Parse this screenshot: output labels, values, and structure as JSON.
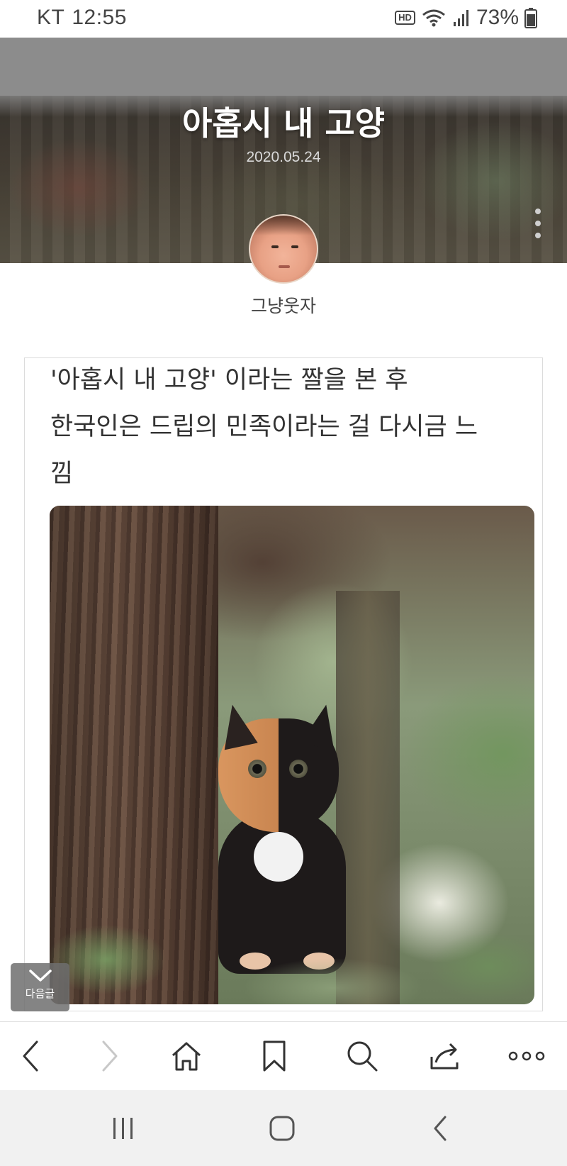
{
  "status_bar": {
    "carrier": "KT",
    "time": "12:55",
    "hd_badge": "HD",
    "battery_percent": "73%",
    "icons": [
      "hd-voice-icon",
      "wifi-icon",
      "signal-icon",
      "battery-icon"
    ]
  },
  "post": {
    "title": "아홉시 내 고양",
    "date": "2020.05.24",
    "author": "그냥웃자",
    "body_lines": [
      "'아홉시 내 고양' 이라는 짤을 본 후",
      "한국인은 드립의 민족이라는 걸 다시금 느",
      "낌"
    ],
    "image_icon": "cat-photo"
  },
  "next_post": {
    "label": "다음글",
    "icon": "chevron-down-icon"
  },
  "browser_toolbar": {
    "buttons": [
      "back-icon",
      "forward-icon",
      "home-icon",
      "bookmark-icon",
      "search-icon",
      "share-icon",
      "more-icon"
    ]
  },
  "system_nav": {
    "buttons": [
      "recent-apps-icon",
      "home-icon",
      "back-icon"
    ]
  },
  "colors": {
    "header_gray": "#8c8c8c",
    "toolbar_bg": "#ffffff",
    "system_nav_bg": "#f1f1f1",
    "disabled_icon": "#c8c8c8",
    "icon": "#333333"
  }
}
